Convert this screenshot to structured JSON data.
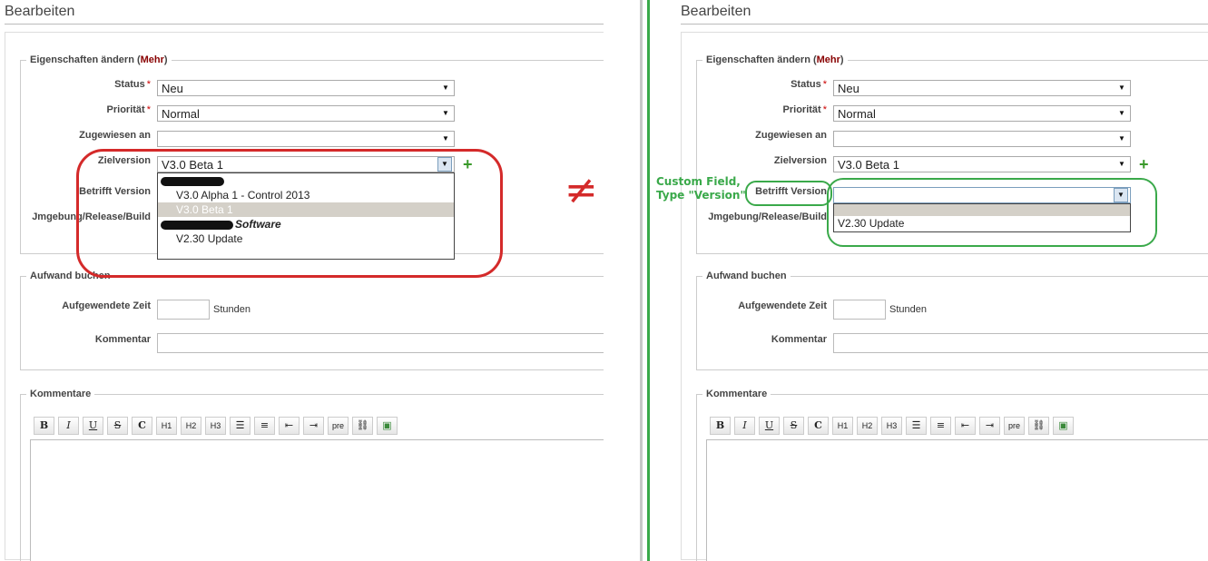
{
  "left": {
    "title": "Bearbeiten",
    "properties_legend": "Eigenschaften ändern (",
    "properties_more": "Mehr",
    "properties_close": ")",
    "fields": {
      "status_label": "Status",
      "status_value": "Neu",
      "priority_label": "Priorität",
      "priority_value": "Normal",
      "assigned_label": "Zugewiesen an",
      "assigned_value": "",
      "target_label": "Zielversion",
      "target_value": "V3.0 Beta 1",
      "affected_label": "Betrifft Version",
      "env_label": "Jmgebung/Release/Build"
    },
    "dropdown": {
      "group1": "",
      "items1": [
        "V3.0 Alpha 1 - Control 2013",
        "V3.0 Beta 1"
      ],
      "group2": "Software",
      "items2": [
        "V2.30 Update"
      ],
      "selected": "V3.0 Beta 1"
    },
    "effort_legend": "Aufwand buchen",
    "time_label": "Aufgewendete Zeit",
    "hours_unit": "Stunden",
    "comment_label": "Kommentar",
    "comments_legend": "Kommentare"
  },
  "right": {
    "title": "Bearbeiten",
    "properties_legend": "Eigenschaften ändern (",
    "properties_more": "Mehr",
    "properties_close": ")",
    "fields": {
      "status_label": "Status",
      "status_value": "Neu",
      "priority_label": "Priorität",
      "priority_value": "Normal",
      "assigned_label": "Zugewiesen an",
      "assigned_value": "",
      "target_label": "Zielversion",
      "target_value": "V3.0 Beta 1",
      "affected_label": "Betrifft Version",
      "affected_value": "",
      "env_label": "Jmgebung/Release/Build"
    },
    "dropdown": {
      "items": [
        "",
        "V2.30 Update"
      ]
    },
    "effort_legend": "Aufwand buchen",
    "time_label": "Aufgewendete Zeit",
    "hours_unit": "Stunden",
    "comment_label": "Kommentar",
    "comments_legend": "Kommentare"
  },
  "toolbar": [
    "B",
    "I",
    "U",
    "S",
    "C",
    "H1",
    "H2",
    "H3",
    "ul",
    "ol",
    "indent-left",
    "indent-right",
    "pre",
    "link",
    "image"
  ],
  "toolbar_pre": "pre",
  "annotations": {
    "not_equal": "≠",
    "custom_field_line1": "Custom Field,",
    "custom_field_line2": "Type \"Version\""
  },
  "colors": {
    "red_annotation": "#d42a2a",
    "green_annotation": "#3aa94a",
    "required": "#cc0000",
    "more_link": "#880000"
  }
}
